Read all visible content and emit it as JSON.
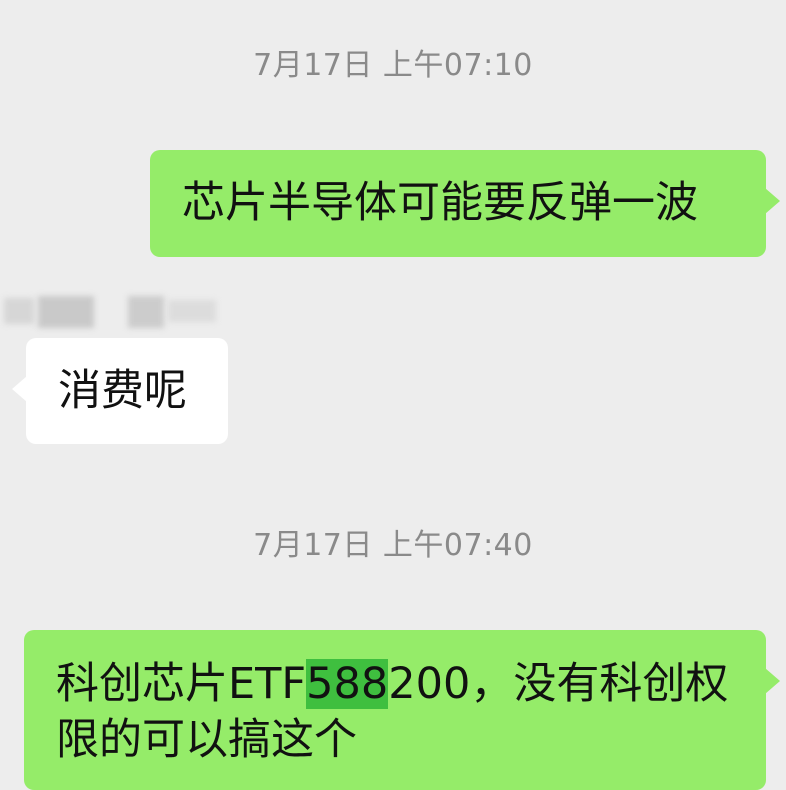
{
  "chat": {
    "timestamp_1": "7月17日 上午07:10",
    "message_1": "芯片半导体可能要反弹一波",
    "message_2": "消费呢",
    "timestamp_2": "7月17日 上午07:40",
    "message_3_part1": "科创芯片ETF",
    "message_3_highlight": "588",
    "message_3_part2": "200，没有科创权限的可以搞这个"
  },
  "colors": {
    "background": "#ededed",
    "sent_bubble": "#95ec69",
    "received_bubble": "#ffffff",
    "highlight": "#3fbf3f",
    "timestamp_text": "#8a8a8a"
  }
}
